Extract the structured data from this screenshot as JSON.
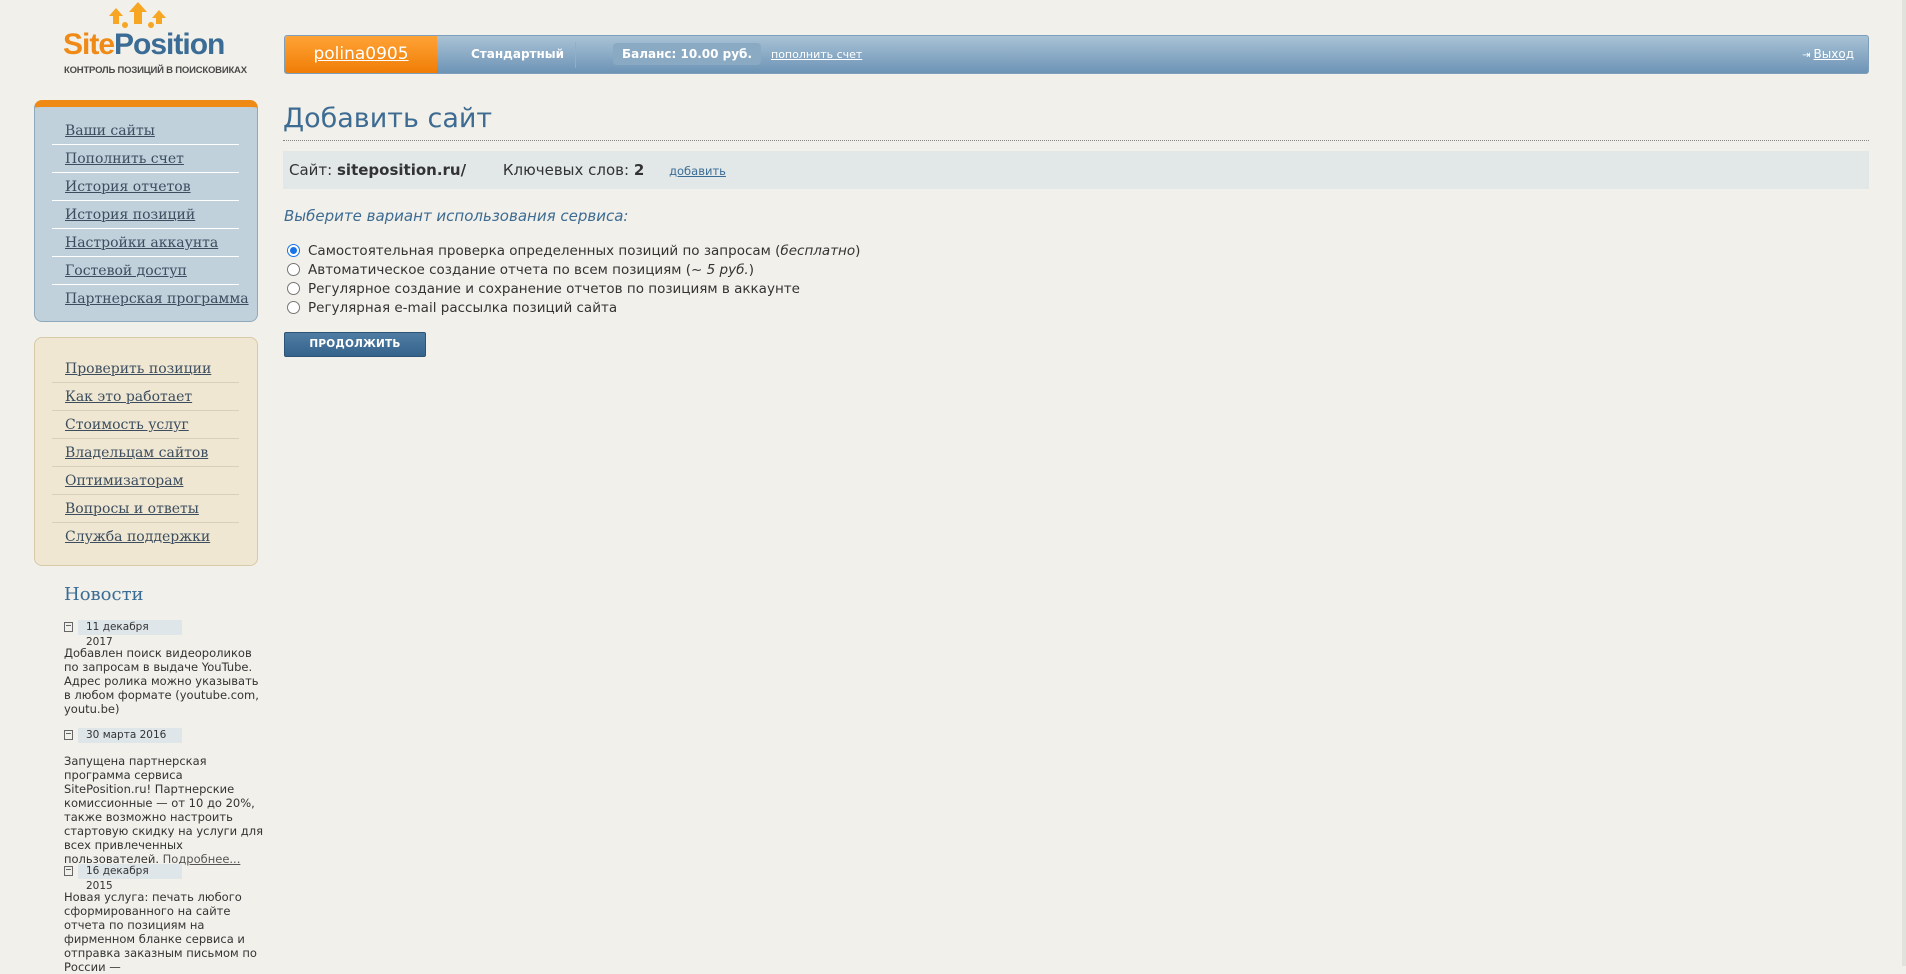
{
  "logo": {
    "name_part1": "Site",
    "name_part2": "Position",
    "tagline": "КОНТРОЛЬ ПОЗИЦИЙ В ПОИСКОВИКАХ"
  },
  "topbar": {
    "username": "polina0905",
    "plan": "Стандартный",
    "balance": "Баланс: 10.00 руб.",
    "topup_link": "пополнить счет",
    "logout_label": "Выход"
  },
  "account_menu": {
    "items": [
      {
        "label": "Ваши сайты"
      },
      {
        "label": "Пополнить счет"
      },
      {
        "label": "История отчетов"
      },
      {
        "label": "История позиций"
      },
      {
        "label": "Настройки аккаунта"
      },
      {
        "label": "Гостевой доступ"
      },
      {
        "label": "Партнерская программа"
      }
    ]
  },
  "info_menu": {
    "items": [
      {
        "label": "Проверить позиции"
      },
      {
        "label": "Как это работает"
      },
      {
        "label": "Стоимость услуг"
      },
      {
        "label": "Владельцам сайтов"
      },
      {
        "label": "Оптимизаторам"
      },
      {
        "label": "Вопросы и ответы"
      },
      {
        "label": "Служба поддержки"
      }
    ]
  },
  "news": {
    "title": "Новости",
    "items": [
      {
        "date": "11 декабря 2017",
        "text": "Добавлен поиск видеороликов по запросам в выдаче YouTube. Адрес ролика можно указывать в любом формате (youtube.com, youtu.be)"
      },
      {
        "date": "30 марта 2016",
        "text": "Запущена партнерская программа сервиса SitePosition.ru! Партнерские комиссионные — от 10 до 20%, также возможно настроить стартовую скидку на услуги для всех привлеченных пользователей.",
        "more": "Подробнее..."
      },
      {
        "date": "16 декабря 2015",
        "text": "Новая услуга: печать любого сформированного на сайте отчета по позициям на фирменном бланке сервиса и отправка заказным письмом по России —"
      }
    ]
  },
  "main": {
    "title": "Добавить сайт",
    "site_label": "Сайт:",
    "site_value": "siteposition.ru/",
    "keywords_label": "Ключевых слов:",
    "keywords_value": "2",
    "add_link": "добавить",
    "choose_label": "Выберите вариант использования сервиса:",
    "options": [
      {
        "text": "Самостоятельная проверка определенных позиций по запросам (",
        "em": "бесплатно",
        "tail": ")",
        "checked": true
      },
      {
        "text": "Автоматическое создание отчета по всем позициям (",
        "em": "~ 5 руб.",
        "tail": ")",
        "checked": false
      },
      {
        "text": "Регулярное создание и сохранение отчетов по позициям в аккаунте",
        "em": "",
        "tail": "",
        "checked": false
      },
      {
        "text": "Регулярная e-mail рассылка позиций сайта",
        "em": "",
        "tail": "",
        "checked": false
      }
    ],
    "continue_label": "ПРОДОЛЖИТЬ"
  },
  "colors": {
    "accent_orange": "#f08a16",
    "brand_blue": "#3d6b92",
    "topbar_blue": "#6d94b6"
  }
}
